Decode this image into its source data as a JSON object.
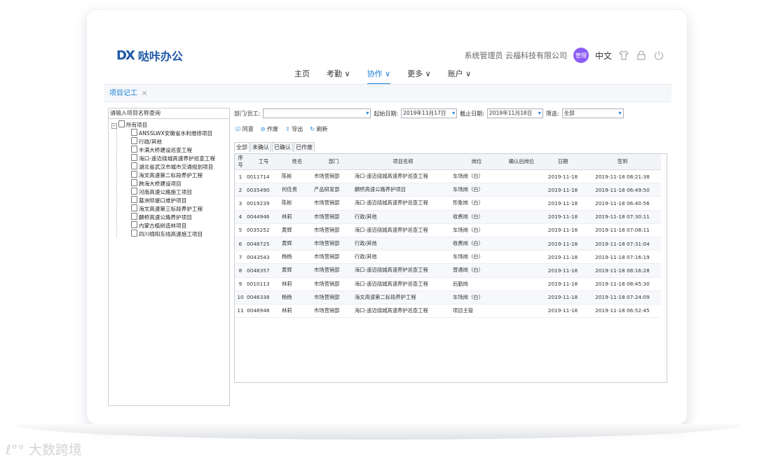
{
  "app": {
    "logo_mark": "DX",
    "logo_text": "哒咔办公"
  },
  "header": {
    "user_text": "系统管理员 云福科技有限公司",
    "badge": "管理",
    "lang": "中文"
  },
  "nav": [
    "主页",
    "考勤 ∨",
    "协作 ∨",
    "更多 ∨",
    "账户 ∨"
  ],
  "tab": {
    "label": "项目记工"
  },
  "tree": {
    "search_placeholder": "请输入项目名称查询",
    "root": "所有项目",
    "items": [
      "ANSSLWX安徽省水利维修项目",
      "行政/其他",
      "丰满大桥建设巡查工程",
      "海口-遥迈绕城高速养护巡查工程",
      "湖北省武汉市城市交通规划项目",
      "海文高速第二标段养护工程",
      "跨海大桥建设项目",
      "河南高速公路施工项目",
      "葛洲坝堤口维护项目",
      "海文高速第三标段养护工程",
      "麟桥高速公路养护项目",
      "内蒙古植树造林项目",
      "四川绵阳东线高速施工项目"
    ]
  },
  "filter": {
    "dept_label": "部门/员工:",
    "dept_value": "",
    "start_label": "起始日期:",
    "start_value": "2019年11月17日",
    "end_label": "截止日期:",
    "end_value": "2019年11月18日",
    "sel_label": "筛选:",
    "sel_value": "全部"
  },
  "toolbar": {
    "agree": "同意",
    "void": "作废",
    "export": "导出",
    "refresh": "刷新"
  },
  "subtabs": [
    "全部",
    "未确认",
    "已确认",
    "已作废"
  ],
  "table": {
    "headers": [
      "序号",
      "工号",
      "姓名",
      "部门",
      "项目名称",
      "岗位",
      "确认后岗位",
      "日期",
      "签到"
    ],
    "rows": [
      [
        "1",
        "0011714",
        "陈彬",
        "市场营销部",
        "海口-遥迈绕城高速养护巡查工程",
        "车场岗（白）",
        "",
        "2019-11-18",
        "2019-11-18 08:21:38"
      ],
      [
        "2",
        "0035490",
        "何佳贵",
        "产品研发部",
        "麟桥高速公路养护项目",
        "车场岗（白）",
        "",
        "2019-11-18",
        "2019-11-18 06:49:50"
      ],
      [
        "3",
        "0019239",
        "陈彬",
        "市场营销部",
        "海口-遥迈绕城高速养护巡查工程",
        "形象岗（白）",
        "",
        "2019-11-18",
        "2019-11-18 06:40:56"
      ],
      [
        "4",
        "0044946",
        "林莉",
        "市场营销部",
        "行政/其他",
        "收费岗（白）",
        "",
        "2019-11-18",
        "2019-11-18 07:30:11"
      ],
      [
        "5",
        "0035252",
        "黄辉",
        "市场营销部",
        "海口-遥迈绕城高速养护巡查工程",
        "车场岗（白）",
        "",
        "2019-11-18",
        "2019-11-18 07:08:11"
      ],
      [
        "6",
        "0048725",
        "黄辉",
        "市场营销部",
        "行政/其他",
        "收费岗（白）",
        "",
        "2019-11-18",
        "2019-11-18 07:31:04"
      ],
      [
        "7",
        "0043543",
        "杨杨",
        "市场营销部",
        "行政/其他",
        "车场岗（白）",
        "",
        "2019-11-18",
        "2019-11-18 07:16:19"
      ],
      [
        "8",
        "0048357",
        "黄辉",
        "市场营销部",
        "海口-遥迈绕城高速养护巡查工程",
        "普通岗（白）",
        "",
        "2019-11-18",
        "2019-11-18 08:16:28"
      ],
      [
        "9",
        "0010113",
        "林莉",
        "市场营销部",
        "海口-遥迈绕城高速养护巡查工程",
        "后勤岗",
        "",
        "2019-11-18",
        "2019-11-18 08:45:30"
      ],
      [
        "10",
        "0046338",
        "杨杨",
        "市场营销部",
        "海文高速第二标段养护工程",
        "车场岗（白）",
        "",
        "2019-11-18",
        "2019-11-18 07:24:09"
      ],
      [
        "11",
        "0048948",
        "林莉",
        "市场营销部",
        "海口-遥迈绕城高速养护巡查工程",
        "项目主管",
        "",
        "2019-11-18",
        "2019-11-18 06:52:45"
      ]
    ]
  }
}
